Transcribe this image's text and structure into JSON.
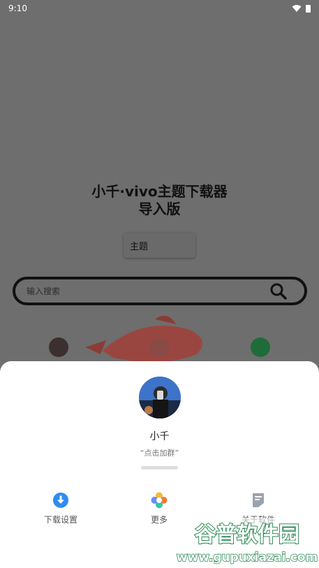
{
  "status_bar": {
    "time": "9:10",
    "icons": [
      "wifi-icon",
      "battery-icon"
    ]
  },
  "app": {
    "title_line1": "小千·vivo主题下载器",
    "title_line2": "导入版",
    "theme_button": "主题",
    "search": {
      "placeholder": "输入搜索",
      "icon": "search-icon"
    }
  },
  "sheet": {
    "profile": {
      "name": "小千",
      "subtitle": "“点击加群”"
    },
    "actions": [
      {
        "label": "下载设置",
        "icon": "download-icon",
        "color": "#2f8cf0"
      },
      {
        "label": "更多",
        "icon": "more-icon",
        "color": "#f07a3a"
      },
      {
        "label": "关于软件",
        "icon": "about-icon",
        "color": "#9aa3ad"
      }
    ]
  },
  "watermark": {
    "text": "谷普软件园",
    "url": "www.gupuxiazai.com"
  },
  "colors": {
    "scrim": "#6e6e6e",
    "sheet": "#ffffff",
    "accent_blue": "#2f8cf0",
    "watermark_green": "#2e8b57"
  }
}
